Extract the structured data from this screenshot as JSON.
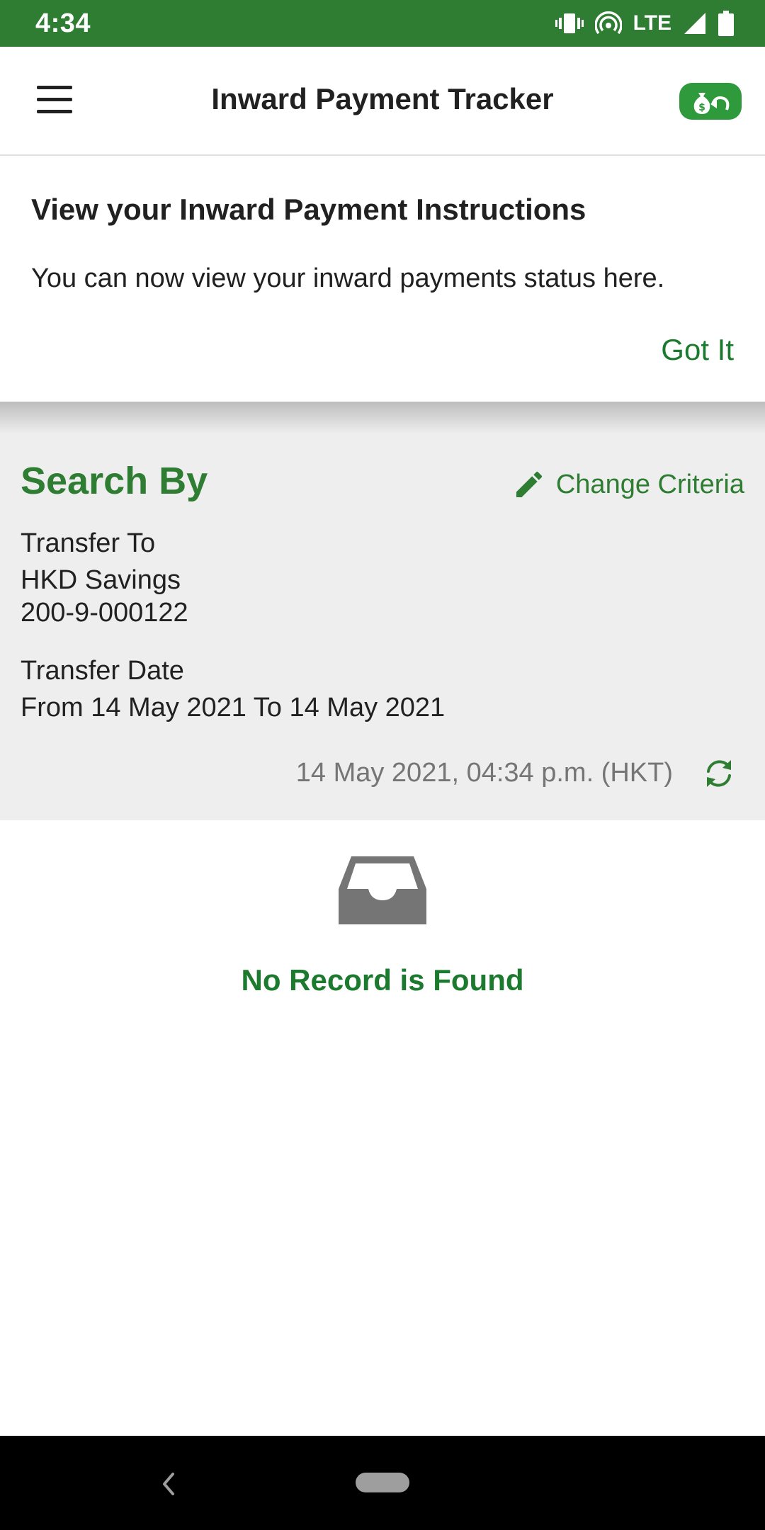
{
  "status_bar": {
    "time": "4:34",
    "network": "LTE",
    "icons": [
      "vibrate-icon",
      "hotspot-icon",
      "signal-icon",
      "battery-icon"
    ]
  },
  "app_bar": {
    "title": "Inward Payment Tracker",
    "menu_icon": "hamburger-menu-icon",
    "action_icon": "money-bag-return-icon"
  },
  "banner": {
    "title": "View your Inward Payment Instructions",
    "message": "You can now view your inward payments status here.",
    "button_label": "Got It"
  },
  "criteria": {
    "heading": "Search By",
    "change_label": "Change Criteria",
    "transfer_to_label": "Transfer To",
    "account_name": "HKD Savings",
    "account_number": "200-9-000122",
    "transfer_date_label": "Transfer Date",
    "date_range": "From 14 May 2021 To 14 May 2021",
    "last_updated": "14 May 2021, 04:34 p.m. (HKT)"
  },
  "empty_state": {
    "icon": "inbox-icon",
    "message": "No Record is Found"
  },
  "colors": {
    "brand_green": "#2e7d32",
    "accent_green": "#1b7a2e",
    "criteria_bg": "#eeeeee"
  }
}
